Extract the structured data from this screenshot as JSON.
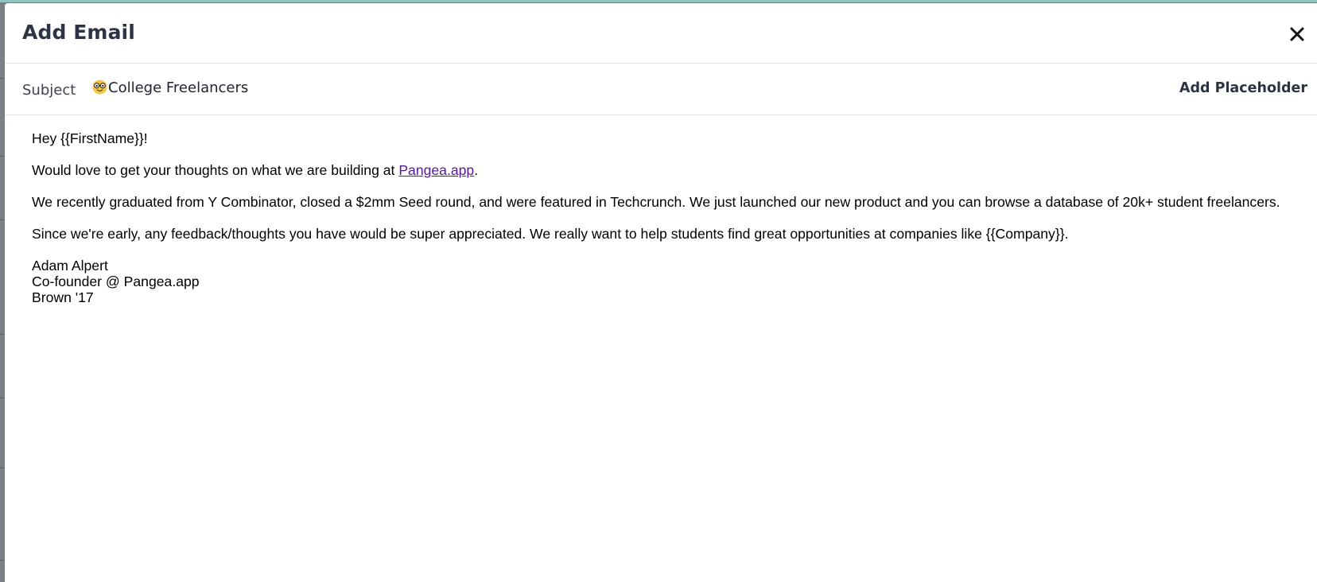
{
  "modal": {
    "title": "Add Email",
    "close_icon": "close-icon"
  },
  "subject": {
    "label": "Subject",
    "emoji_icon": "nerd-face-emoji-icon",
    "value": "College Freelancers",
    "add_placeholder_label": "Add Placeholder"
  },
  "body": {
    "greeting": "Hey {{FirstName}}!",
    "p2_before": "Would love to get your thoughts on what we are building at ",
    "p2_link": "Pangea.app",
    "p2_after": ".",
    "p3": "We recently graduated from Y Combinator, closed a $2mm Seed round, and were featured in Techcrunch.  We just launched our new product and you can browse a database of 20k+ student freelancers.",
    "p4": "Since we're early, any feedback/thoughts you have would be super appreciated. We really want to help students find great opportunities at companies like {{Company}}.",
    "signature": {
      "name": "Adam Alpert",
      "role": "Co-founder @ Pangea.app",
      "school": "Brown '17"
    }
  },
  "colors": {
    "title": "#2c3345",
    "link": "#551a8b",
    "divider": "#dfe1e6",
    "backdrop": "#7d7f86",
    "topline": "#8fc4c3"
  }
}
